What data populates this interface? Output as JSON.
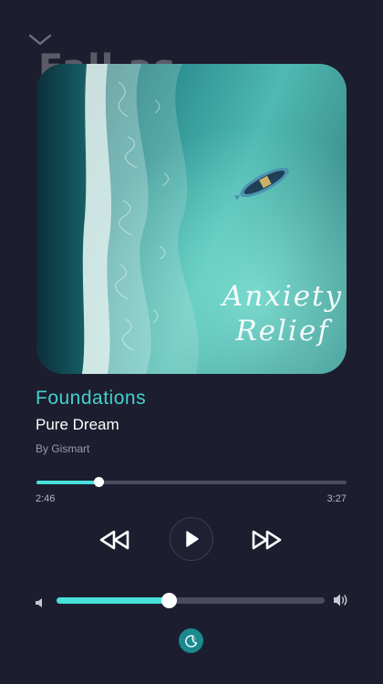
{
  "player": {
    "background_title": "Fall as",
    "artwork_text_line1": "Anxiety",
    "artwork_text_line2": "Relief",
    "track_title": "Foundations",
    "track_subtitle": "Pure Dream",
    "artist": "By Gismart",
    "elapsed": "2:46",
    "total": "3:27",
    "progress_fraction": 0.2,
    "volume_fraction": 0.42
  },
  "icons": {
    "collapse": "chevron-down-icon",
    "rewind": "rewind-icon",
    "play": "play-icon",
    "fast_forward": "fast-forward-icon",
    "volume_low": "volume-low-icon",
    "volume_high": "volume-high-icon",
    "sleep_timer": "moon-timer-icon"
  },
  "colors": {
    "background": "#1c1d2e",
    "accent": "#48e0da",
    "title": "#43d2cf",
    "track": "#4a4c5d"
  }
}
